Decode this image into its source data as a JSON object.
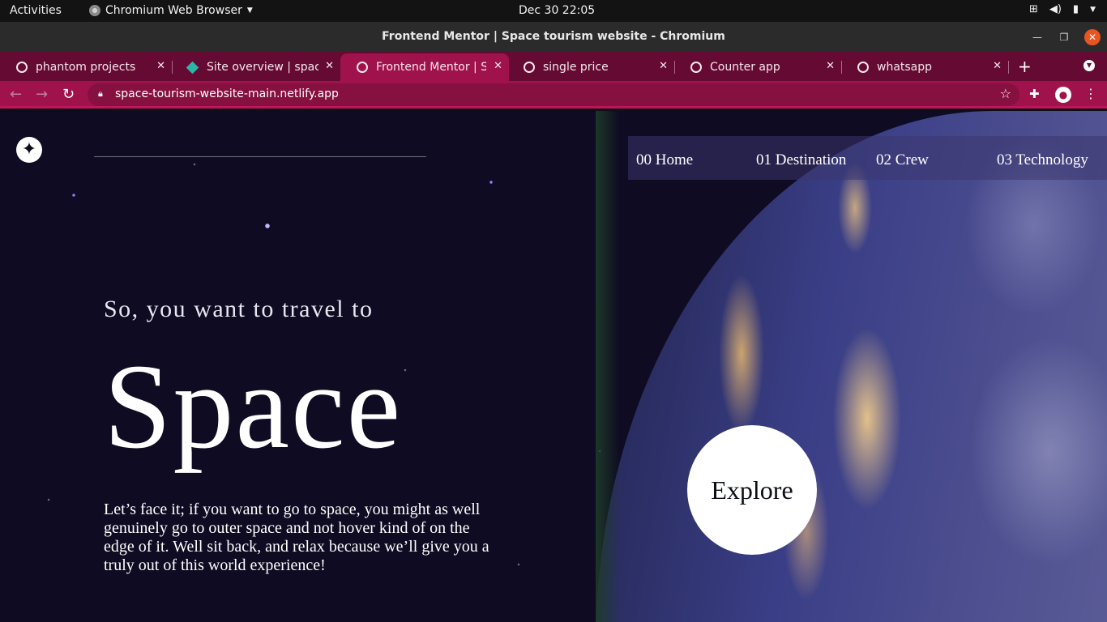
{
  "system": {
    "activities": "Activities",
    "app_menu": "Chromium Web Browser",
    "clock": "Dec 30  22:05"
  },
  "window": {
    "title": "Frontend Mentor | Space tourism website - Chromium"
  },
  "tabs": [
    {
      "label": "phantom projects",
      "icon": "globe-icon"
    },
    {
      "label": "Site overview | space-",
      "icon": "netlify-diamond-icon"
    },
    {
      "label": "Frontend Mentor | Sp",
      "icon": "globe-icon",
      "active": true
    },
    {
      "label": "single price",
      "icon": "globe-icon"
    },
    {
      "label": "Counter app",
      "icon": "globe-icon"
    },
    {
      "label": "whatsapp",
      "icon": "globe-icon"
    }
  ],
  "toolbar": {
    "url": "space-tourism-website-main.netlify.app"
  },
  "site": {
    "nav": [
      {
        "number": "00",
        "label": "Home"
      },
      {
        "number": "01",
        "label": "Destination"
      },
      {
        "number": "02",
        "label": "Crew"
      },
      {
        "number": "03",
        "label": "Technology"
      }
    ],
    "nav_text": [
      "00 Home",
      "01 Destination",
      "02 Crew",
      "03 Technology"
    ],
    "hero_subtitle": "So, you want to travel to",
    "hero_title": "Space",
    "hero_body": "Let’s face it; if you want to go to space, you might as well genuinely go to outer space and not hover kind of on the edge of it. Well sit back, and relax because we’ll give you a truly out of this world experience!",
    "cta": "Explore"
  },
  "colors": {
    "tab_strip": "#650b33",
    "toolbar": "#a0124c",
    "page_background": "#0b0d17",
    "accent_close": "#e95420"
  }
}
